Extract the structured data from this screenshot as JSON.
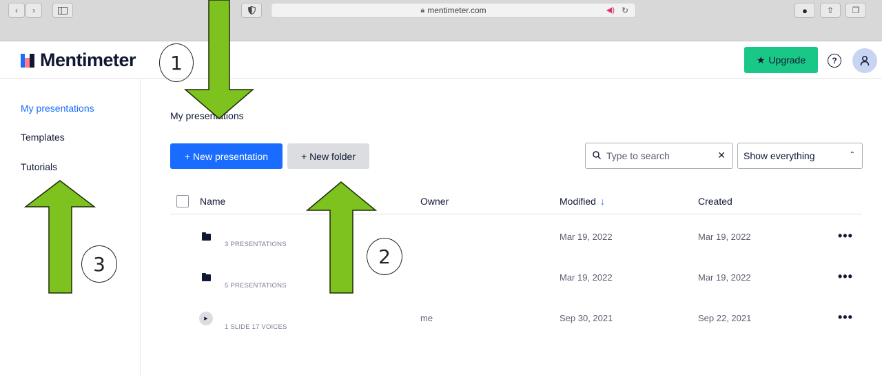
{
  "browser": {
    "url": "mentimeter.com"
  },
  "header": {
    "logo_text": "Mentimeter",
    "upgrade_label": "Upgrade",
    "help_glyph": "?",
    "colors": {
      "accent_green": "#19c887",
      "brand_blue": "#196cff"
    }
  },
  "sidebar": {
    "items": [
      {
        "label": "My presentations",
        "active": true
      },
      {
        "label": "Templates",
        "active": false
      },
      {
        "label": "Tutorials",
        "active": false
      }
    ]
  },
  "main": {
    "title": "My presentations",
    "new_presentation_label": "+ New presentation",
    "new_folder_label": "+ New folder",
    "search": {
      "placeholder": "Type to search",
      "value": ""
    },
    "filter": {
      "selected": "Show everything"
    },
    "table": {
      "columns": {
        "name": "Name",
        "owner": "Owner",
        "modified": "Modified",
        "created": "Created"
      },
      "rows": [
        {
          "kind": "folder",
          "meta": "3 PRESENTATIONS",
          "owner": "",
          "modified": "Mar 19, 2022",
          "created": "Mar 19, 2022",
          "more": "•••"
        },
        {
          "kind": "folder",
          "meta": "5 PRESENTATIONS",
          "owner": "",
          "modified": "Mar 19, 2022",
          "created": "Mar 19, 2022",
          "more": "•••"
        },
        {
          "kind": "presentation",
          "meta": "1 SLIDE 17 VOICES",
          "owner": "me",
          "modified": "Sep 30, 2021",
          "created": "Sep 22, 2021",
          "more": "•••"
        }
      ]
    }
  },
  "annotations": {
    "labels": [
      "1",
      "2",
      "3"
    ],
    "arrow_color": "#7dc21e"
  }
}
